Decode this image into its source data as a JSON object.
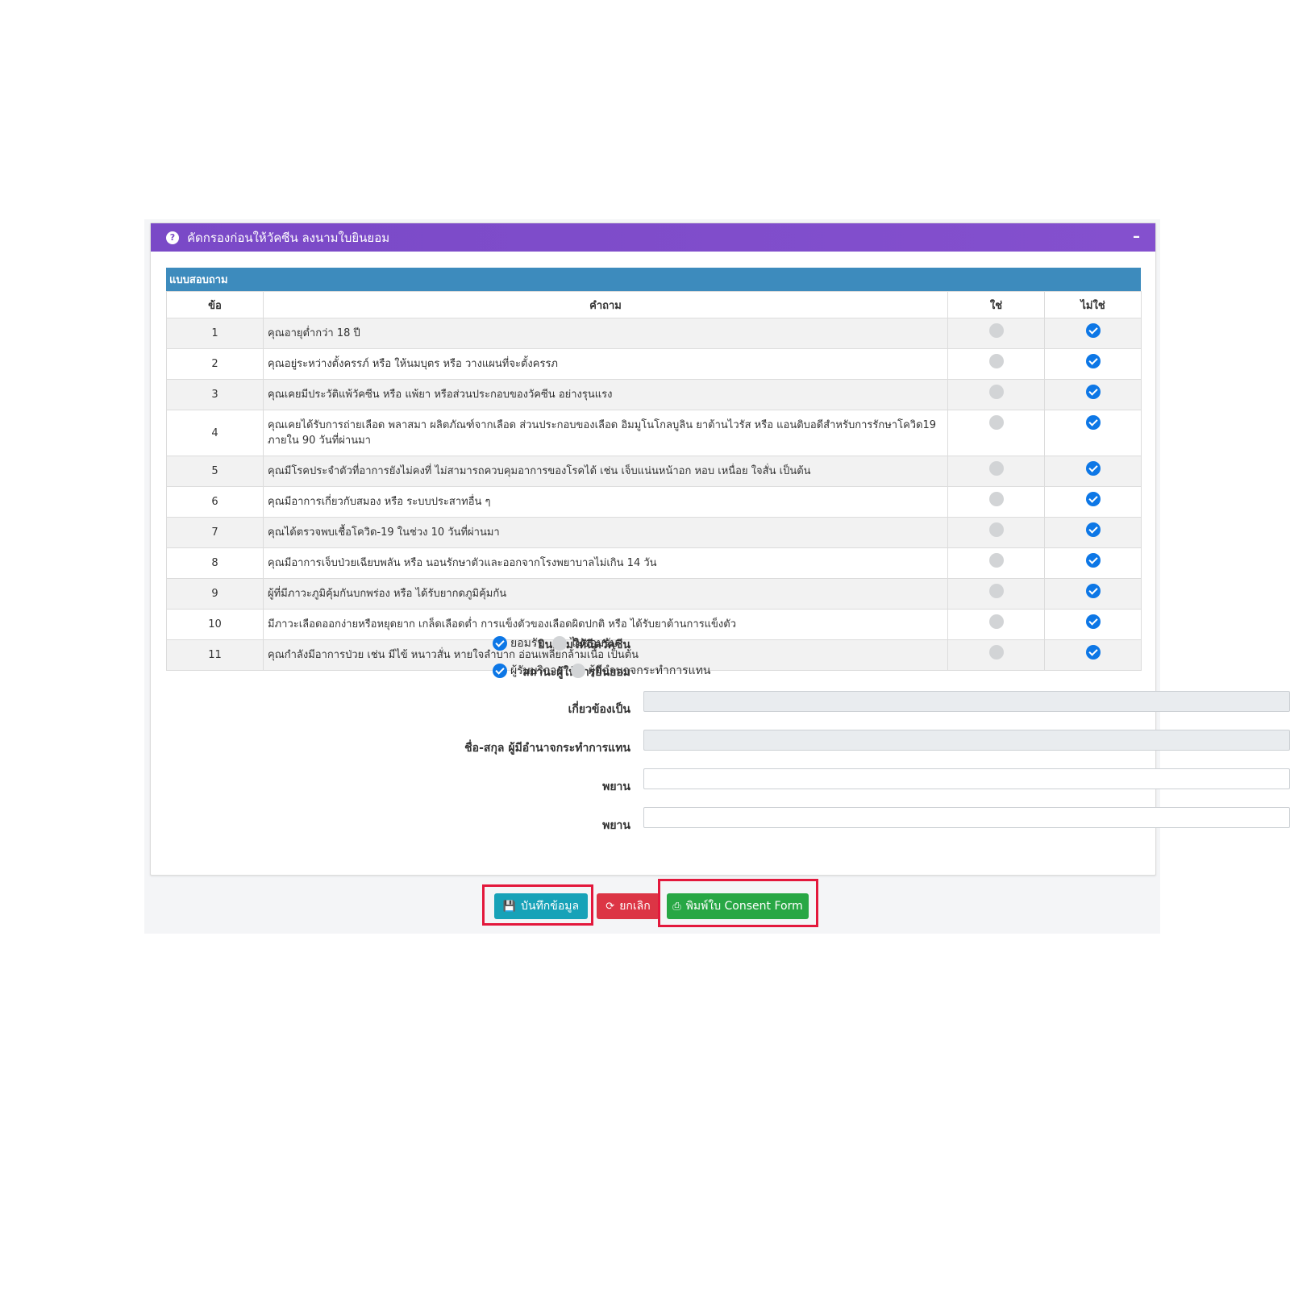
{
  "header": {
    "title": "คัดกรองก่อนให้วัคซีน ลงนามใบยินยอม",
    "collapse_label": "–"
  },
  "questionnaire": {
    "title": "แบบสอบถาม",
    "columns": [
      "ข้อ",
      "คำถาม",
      "ใช่",
      "ไม่ใช่"
    ],
    "rows": [
      {
        "no": "1",
        "question": "คุณอายุต่ำกว่า 18 ปี",
        "answer": "no"
      },
      {
        "no": "2",
        "question": "คุณอยู่ระหว่างตั้งครรภ์ หรือ ให้นมบุตร หรือ วางแผนที่จะตั้งครรภ",
        "answer": "no"
      },
      {
        "no": "3",
        "question": "คุณเคยมีประวัติแพ้วัคซีน หรือ แพ้ยา หรือส่วนประกอบของวัคซีน อย่างรุนแรง",
        "answer": "no"
      },
      {
        "no": "4",
        "question": "คุณเคยได้รับการถ่ายเลือด พลาสมา ผลิตภัณฑ์จากเลือด ส่วนประกอบของเลือด อิมมูโนโกลบูลิน ยาต้านไวรัส หรือ แอนติบอดีสำหรับการรักษาโควิด19 ภายใน 90 วันที่ผ่านมา",
        "answer": "no"
      },
      {
        "no": "5",
        "question": "คุณมีโรคประจำตัวที่อาการยังไม่คงที่ ไม่สามารถควบคุมอาการของโรคได้ เช่น เจ็บแน่นหน้าอก หอบ เหนื่อย ใจสั่น เป็นต้น",
        "answer": "no"
      },
      {
        "no": "6",
        "question": "คุณมีอาการเกี่ยวกับสมอง หรือ ระบบประสาทอื่น ๆ",
        "answer": "no"
      },
      {
        "no": "7",
        "question": "คุณได้ตรวจพบเชื้อโควิด-19 ในช่วง 10 วันที่ผ่านมา",
        "answer": "no"
      },
      {
        "no": "8",
        "question": "คุณมีอาการเจ็บป่วยเฉียบพลัน หรือ นอนรักษาตัวและออกจากโรงพยาบาลไม่เกิน 14 วัน",
        "answer": "no"
      },
      {
        "no": "9",
        "question": "ผู้ที่มีภาวะภูมิคุ้มกันบกพร่อง หรือ ได้รับยากดภูมิคุ้มกัน",
        "answer": "no"
      },
      {
        "no": "10",
        "question": "มีภาวะเลือดออกง่ายหรือหยุดยาก เกล็ดเลือดต่ำ การแข็งตัวของเลือดผิดปกติ หรือ ได้รับยาต้านการแข็งตัว",
        "answer": "no"
      },
      {
        "no": "11",
        "question": "คุณกำลังมีอาการป่วย เช่น มีไข้ หนาวสั่น หายใจลำบาก อ่อนเพลียกล้ามเนื้อ เป็นต้น",
        "answer": "no"
      }
    ]
  },
  "consent": {
    "label": "ยินยอมให้ฉีดวัคซีน",
    "options": [
      {
        "label": "ยอมรับ",
        "selected": true
      },
      {
        "label": "ไม่ยอมรับ",
        "selected": false
      }
    ]
  },
  "consenter_status": {
    "label": "สถานะผู้ให้การยินยอม",
    "options": [
      {
        "label": "ผู้รับบริการ",
        "selected": true
      },
      {
        "label": "ผู้มีอำนาจกระทำการแทน",
        "selected": false
      }
    ]
  },
  "fields": {
    "relation": {
      "label": "เกี่ยวข้องเป็น",
      "value": ""
    },
    "representative_name": {
      "label": "ชื่อ-สกุล ผู้มีอำนาจกระทำการแทน",
      "value": ""
    },
    "witness1": {
      "label": "พยาน",
      "value": ""
    },
    "witness2": {
      "label": "พยาน",
      "value": ""
    }
  },
  "buttons": {
    "save": "บันทึกข้อมูล",
    "cancel": "ยกเลิก",
    "print": "พิมพ์ใบ Consent Form"
  },
  "colors": {
    "header": "#7a49c7",
    "table_title": "#3d8bbd",
    "check": "#0d77e6",
    "save": "#17a2b8",
    "cancel": "#dc3545",
    "print": "#28a745",
    "highlight": "#e3183c"
  },
  "icons": {
    "header": "question-circle-icon",
    "save": "save-icon",
    "cancel": "refresh-icon",
    "print": "printer-icon"
  }
}
